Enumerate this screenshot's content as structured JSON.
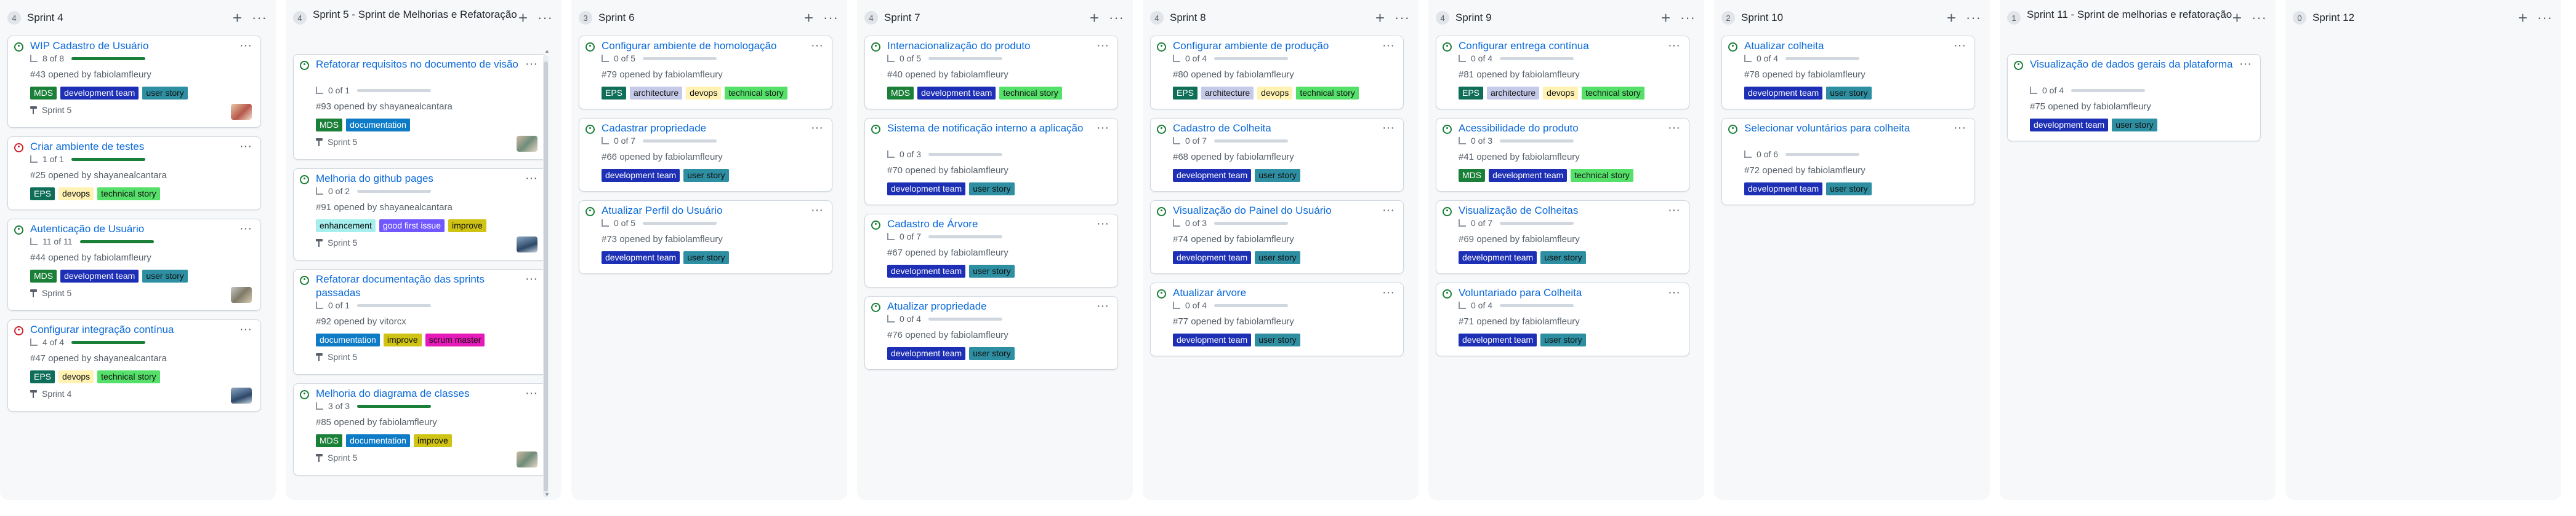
{
  "columns": [
    {
      "count": "4",
      "title": "Sprint 4",
      "cards": [
        {
          "status": "green",
          "title": "WIP Cadastro de Usuário",
          "progress_text": "8 of 8",
          "progress": 1.0,
          "meta": "#43 opened by fabiolamfleury",
          "labels": [
            {
              "text": "MDS",
              "style": "mds"
            },
            {
              "text": "development team",
              "style": "dev"
            },
            {
              "text": "user story",
              "style": "us"
            }
          ],
          "milestone": "Sprint 5",
          "avatar": "a"
        },
        {
          "status": "red",
          "title": "Criar ambiente de testes",
          "progress_text": "1 of 1",
          "progress": 1.0,
          "meta": "#25 opened by shayanealcantara",
          "labels": [
            {
              "text": "EPS",
              "style": "eps"
            },
            {
              "text": "devops",
              "style": "devops"
            },
            {
              "text": "technical story",
              "style": "tech"
            }
          ]
        },
        {
          "status": "green",
          "title": "Autenticação de Usuário",
          "progress_text": "11 of 11",
          "progress": 1.0,
          "meta": "#44 opened by fabiolamfleury",
          "labels": [
            {
              "text": "MDS",
              "style": "mds"
            },
            {
              "text": "development team",
              "style": "dev"
            },
            {
              "text": "user story",
              "style": "us"
            }
          ],
          "milestone": "Sprint 5",
          "avatar": "b"
        },
        {
          "status": "red",
          "title": "Configurar integração contínua",
          "progress_text": "4 of 4",
          "progress": 1.0,
          "meta": "#47 opened by shayanealcantara",
          "labels": [
            {
              "text": "EPS",
              "style": "eps"
            },
            {
              "text": "devops",
              "style": "devops"
            },
            {
              "text": "technical story",
              "style": "tech"
            }
          ],
          "milestone": "Sprint 4",
          "avatar": "c"
        }
      ]
    },
    {
      "count": "4",
      "title": "Sprint 5 - Sprint de Melhorias e Refatoração",
      "cards": [
        {
          "status": "green",
          "title": "Refatorar requisitos no documento de visão",
          "progress_text": "0 of 1",
          "progress": 0,
          "meta": "#93 opened by shayanealcantara",
          "labels": [
            {
              "text": "MDS",
              "style": "mds"
            },
            {
              "text": "documentation",
              "style": "doc"
            }
          ],
          "milestone": "Sprint 5",
          "avatar": "e"
        },
        {
          "status": "green",
          "title": "Melhoria do github pages",
          "progress_text": "0 of 2",
          "progress": 0,
          "meta": "#91 opened by shayanealcantara",
          "labels": [
            {
              "text": "enhancement",
              "style": "enh"
            },
            {
              "text": "good first issue",
              "style": "gfi"
            },
            {
              "text": "improve",
              "style": "imp"
            }
          ],
          "milestone": "Sprint 5",
          "avatar": "c"
        },
        {
          "status": "green",
          "title": "Refatorar documentação das sprints passadas",
          "progress_text": "0 of 1",
          "progress": 0,
          "meta": "#92 opened by vitorcx",
          "labels": [
            {
              "text": "documentation",
              "style": "doc"
            },
            {
              "text": "improve",
              "style": "imp"
            },
            {
              "text": "scrum master",
              "style": "scrum"
            }
          ],
          "milestone": "Sprint 5"
        },
        {
          "status": "green",
          "title": "Melhoria do diagrama de classes",
          "progress_text": "3 of 3",
          "progress": 1.0,
          "meta": "#85 opened by fabiolamfleury",
          "labels": [
            {
              "text": "MDS",
              "style": "mds"
            },
            {
              "text": "documentation",
              "style": "doc"
            },
            {
              "text": "improve",
              "style": "imp"
            }
          ],
          "milestone": "Sprint 5",
          "avatar": "e"
        }
      ]
    },
    {
      "count": "3",
      "title": "Sprint 6",
      "cards": [
        {
          "status": "green",
          "title": "Configurar ambiente de homologação",
          "progress_text": "0 of 5",
          "progress": 0,
          "meta": "#79 opened by fabiolamfleury",
          "labels": [
            {
              "text": "EPS",
              "style": "eps"
            },
            {
              "text": "architecture",
              "style": "arch"
            },
            {
              "text": "devops",
              "style": "devops"
            },
            {
              "text": "technical story",
              "style": "tech"
            }
          ]
        },
        {
          "status": "green",
          "title": "Cadastrar propriedade",
          "progress_text": "0 of 7",
          "progress": 0,
          "meta": "#66 opened by fabiolamfleury",
          "labels": [
            {
              "text": "development team",
              "style": "dev"
            },
            {
              "text": "user story",
              "style": "us"
            }
          ]
        },
        {
          "status": "green",
          "title": "Atualizar Perfil do Usuário",
          "progress_text": "0 of 5",
          "progress": 0,
          "meta": "#73 opened by fabiolamfleury",
          "labels": [
            {
              "text": "development team",
              "style": "dev"
            },
            {
              "text": "user story",
              "style": "us"
            }
          ]
        }
      ]
    },
    {
      "count": "4",
      "title": "Sprint 7",
      "cards": [
        {
          "status": "green",
          "title": "Internacionalização do produto",
          "progress_text": "0 of 5",
          "progress": 0,
          "meta": "#40 opened by fabiolamfleury",
          "labels": [
            {
              "text": "MDS",
              "style": "mds"
            },
            {
              "text": "development team",
              "style": "dev"
            },
            {
              "text": "technical story",
              "style": "tech"
            }
          ]
        },
        {
          "status": "green",
          "title": "Sistema de notificação interno a aplicação",
          "progress_text": "0 of 3",
          "progress": 0,
          "meta": "#70 opened by fabiolamfleury",
          "labels": [
            {
              "text": "development team",
              "style": "dev"
            },
            {
              "text": "user story",
              "style": "us"
            }
          ]
        },
        {
          "status": "green",
          "title": "Cadastro de Árvore",
          "progress_text": "0 of 7",
          "progress": 0,
          "meta": "#67 opened by fabiolamfleury",
          "labels": [
            {
              "text": "development team",
              "style": "dev"
            },
            {
              "text": "user story",
              "style": "us"
            }
          ]
        },
        {
          "status": "green",
          "title": "Atualizar propriedade",
          "progress_text": "0 of 4",
          "progress": 0,
          "meta": "#76 opened by fabiolamfleury",
          "labels": [
            {
              "text": "development team",
              "style": "dev"
            },
            {
              "text": "user story",
              "style": "us"
            }
          ]
        }
      ]
    },
    {
      "count": "4",
      "title": "Sprint 8",
      "cards": [
        {
          "status": "green",
          "title": "Configurar ambiente de produção",
          "progress_text": "0 of 4",
          "progress": 0,
          "meta": "#80 opened by fabiolamfleury",
          "labels": [
            {
              "text": "EPS",
              "style": "eps"
            },
            {
              "text": "architecture",
              "style": "arch"
            },
            {
              "text": "devops",
              "style": "devops"
            },
            {
              "text": "technical story",
              "style": "tech"
            }
          ]
        },
        {
          "status": "green",
          "title": "Cadastro de Colheita",
          "progress_text": "0 of 7",
          "progress": 0,
          "meta": "#68 opened by fabiolamfleury",
          "labels": [
            {
              "text": "development team",
              "style": "dev"
            },
            {
              "text": "user story",
              "style": "us"
            }
          ]
        },
        {
          "status": "green",
          "title": "Visualização do Painel do Usuário",
          "progress_text": "0 of 3",
          "progress": 0,
          "meta": "#74 opened by fabiolamfleury",
          "labels": [
            {
              "text": "development team",
              "style": "dev"
            },
            {
              "text": "user story",
              "style": "us"
            }
          ]
        },
        {
          "status": "green",
          "title": "Atualizar árvore",
          "progress_text": "0 of 4",
          "progress": 0,
          "meta": "#77 opened by fabiolamfleury",
          "labels": [
            {
              "text": "development team",
              "style": "dev"
            },
            {
              "text": "user story",
              "style": "us"
            }
          ]
        }
      ]
    },
    {
      "count": "4",
      "title": "Sprint 9",
      "cards": [
        {
          "status": "green",
          "title": "Configurar entrega contínua",
          "progress_text": "0 of 4",
          "progress": 0,
          "meta": "#81 opened by fabiolamfleury",
          "labels": [
            {
              "text": "EPS",
              "style": "eps"
            },
            {
              "text": "architecture",
              "style": "arch"
            },
            {
              "text": "devops",
              "style": "devops"
            },
            {
              "text": "technical story",
              "style": "tech"
            }
          ]
        },
        {
          "status": "green",
          "title": "Acessibilidade do produto",
          "progress_text": "0 of 3",
          "progress": 0,
          "meta": "#41 opened by fabiolamfleury",
          "labels": [
            {
              "text": "MDS",
              "style": "mds"
            },
            {
              "text": "development team",
              "style": "dev"
            },
            {
              "text": "technical story",
              "style": "tech"
            }
          ]
        },
        {
          "status": "green",
          "title": "Visualização de Colheitas",
          "progress_text": "0 of 7",
          "progress": 0,
          "meta": "#69 opened by fabiolamfleury",
          "labels": [
            {
              "text": "development team",
              "style": "dev"
            },
            {
              "text": "user story",
              "style": "us"
            }
          ]
        },
        {
          "status": "green",
          "title": "Voluntariado para Colheita",
          "progress_text": "0 of 4",
          "progress": 0,
          "meta": "#71 opened by fabiolamfleury",
          "labels": [
            {
              "text": "development team",
              "style": "dev"
            },
            {
              "text": "user story",
              "style": "us"
            }
          ]
        }
      ]
    },
    {
      "count": "2",
      "title": "Sprint 10",
      "cards": [
        {
          "status": "green",
          "title": "Atualizar colheita",
          "progress_text": "0 of 4",
          "progress": 0,
          "meta": "#78 opened by fabiolamfleury",
          "labels": [
            {
              "text": "development team",
              "style": "dev"
            },
            {
              "text": "user story",
              "style": "us"
            }
          ]
        },
        {
          "status": "green",
          "title": "Selecionar voluntários para colheita",
          "progress_text": "0 of 6",
          "progress": 0,
          "meta": "#72 opened by fabiolamfleury",
          "labels": [
            {
              "text": "development team",
              "style": "dev"
            },
            {
              "text": "user story",
              "style": "us"
            }
          ]
        }
      ]
    },
    {
      "count": "1",
      "title": "Sprint 11 - Sprint de melhorias e refatoração",
      "cards": [
        {
          "status": "green",
          "title": "Visualização de dados gerais da plataforma",
          "progress_text": "0 of 4",
          "progress": 0,
          "meta": "#75 opened by fabiolamfleury",
          "labels": [
            {
              "text": "development team",
              "style": "dev"
            },
            {
              "text": "user story",
              "style": "us"
            }
          ]
        }
      ]
    },
    {
      "count": "0",
      "title": "Sprint 12",
      "cards": []
    }
  ]
}
